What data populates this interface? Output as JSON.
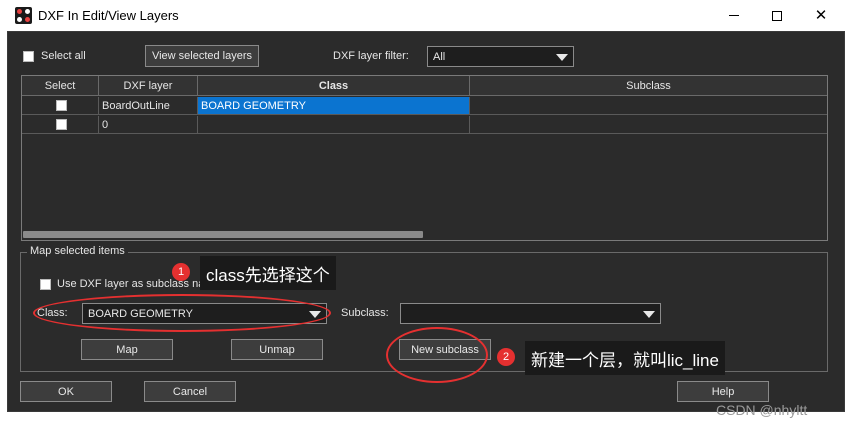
{
  "window": {
    "title": "DXF In Edit/View Layers"
  },
  "toolbar": {
    "select_all_label": "Select all",
    "view_selected_label": "View selected layers",
    "filter_label": "DXF layer filter:",
    "filter_value": "All"
  },
  "table": {
    "headers": [
      "Select",
      "DXF layer",
      "Class",
      "Subclass"
    ],
    "rows": [
      {
        "dxf_layer": "BoardOutLine",
        "class": "BOARD GEOMETRY",
        "subclass": ""
      },
      {
        "dxf_layer": "0",
        "class": "",
        "subclass": ""
      }
    ]
  },
  "map_group": {
    "title": "Map selected items",
    "use_dxf_label": "Use DXF layer as subclass name",
    "class_label": "Class:",
    "class_value": "BOARD GEOMETRY",
    "subclass_label": "Subclass:",
    "subclass_value": "",
    "map_label": "Map",
    "unmap_label": "Unmap",
    "new_subclass_label": "New subclass"
  },
  "footer": {
    "ok_label": "OK",
    "cancel_label": "Cancel",
    "help_label": "Help"
  },
  "annotations": {
    "badge1": "1",
    "note1": "class先选择这个",
    "badge2": "2",
    "note2": "新建一个层，就叫lic_line",
    "color": "#e53030"
  },
  "watermark": "CSDN @nhyltt"
}
